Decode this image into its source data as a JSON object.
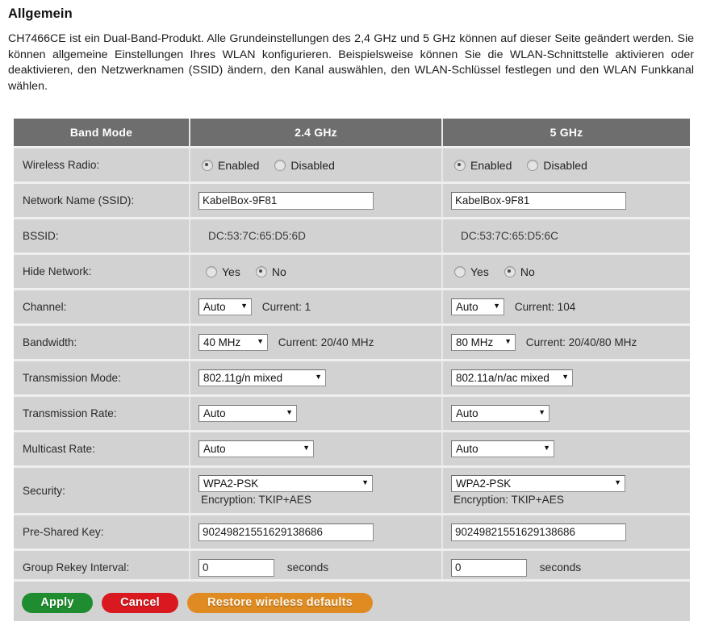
{
  "page": {
    "heading": "Allgemein",
    "intro": "CH7466CE ist ein Dual-Band-Produkt. Alle Grundeinstellungen des 2,4 GHz und 5 GHz können auf dieser Seite geändert werden. Sie können allgemeine Einstellungen Ihres WLAN konfigurieren. Beispielsweise können Sie die WLAN-Schnittstelle aktivieren oder deaktivieren, den Netzwerknamen (SSID) ändern, den Kanal auswählen, den WLAN-Schlüssel festlegen und den WLAN Funkkanal wählen."
  },
  "table": {
    "headers": {
      "band_mode": "Band Mode",
      "band_24": "2.4 GHz",
      "band_5": "5 GHz"
    },
    "labels": {
      "wireless_radio": "Wireless Radio:",
      "ssid": "Network Name (SSID):",
      "bssid": "BSSID:",
      "hide_network": "Hide Network:",
      "channel": "Channel:",
      "bandwidth": "Bandwidth:",
      "transmission_mode": "Transmission Mode:",
      "transmission_rate": "Transmission Rate:",
      "multicast_rate": "Multicast Rate:",
      "security": "Security:",
      "psk": "Pre-Shared Key:",
      "group_rekey": "Group Rekey Interval:"
    },
    "common": {
      "enabled": "Enabled",
      "disabled": "Disabled",
      "yes": "Yes",
      "no": "No",
      "seconds": "seconds",
      "caret": "▼"
    },
    "band24": {
      "radio_selected": "Enabled",
      "ssid_value": "KabelBox-9F81",
      "bssid_value": "DC:53:7C:65:D5:6D",
      "hide_selected": "No",
      "channel_select": "Auto",
      "channel_current": "Current: 1",
      "bandwidth_select": "40 MHz",
      "bandwidth_current": "Current: 20/40 MHz",
      "transmission_mode_select": "802.11g/n mixed",
      "transmission_rate_select": "Auto",
      "multicast_rate_select": "Auto",
      "security_select": "WPA2-PSK",
      "encryption_text": "Encryption: TKIP+AES",
      "psk_value": "90249821551629138686",
      "group_rekey_value": "0"
    },
    "band5": {
      "radio_selected": "Enabled",
      "ssid_value": "KabelBox-9F81",
      "bssid_value": "DC:53:7C:65:D5:6C",
      "hide_selected": "No",
      "channel_select": "Auto",
      "channel_current": "Current: 104",
      "bandwidth_select": "80 MHz",
      "bandwidth_current": "Current: 20/40/80 MHz",
      "transmission_mode_select": "802.11a/n/ac mixed",
      "transmission_rate_select": "Auto",
      "multicast_rate_select": "Auto",
      "security_select": "WPA2-PSK",
      "encryption_text": "Encryption: TKIP+AES",
      "psk_value": "90249821551629138686",
      "group_rekey_value": "0"
    }
  },
  "buttons": {
    "apply": "Apply",
    "cancel": "Cancel",
    "restore": "Restore wireless defaults"
  },
  "colors": {
    "header_bg": "#6e6e6e",
    "row_bg": "#d2d2d2",
    "apply": "#1e8c2f",
    "cancel": "#d9191f",
    "restore": "#e08b21"
  }
}
